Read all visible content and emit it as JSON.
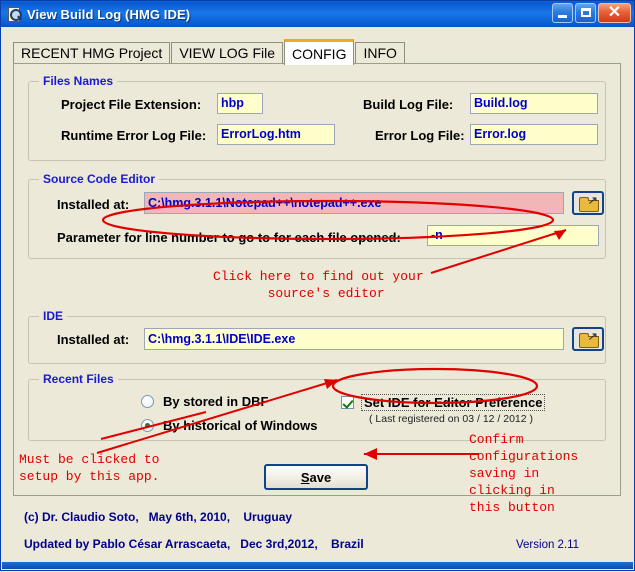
{
  "window": {
    "title": "View Build Log (HMG IDE)",
    "icon": "magnifier-document-icon",
    "buttons": {
      "minimize": "minimize-icon",
      "maximize": "maximize-icon",
      "close": "close-icon"
    }
  },
  "tabs": [
    {
      "label": "RECENT HMG Project",
      "active": false
    },
    {
      "label": "VIEW LOG File",
      "active": false
    },
    {
      "label": "CONFIG",
      "active": true
    },
    {
      "label": "INFO",
      "active": false
    }
  ],
  "groups": {
    "files_names": {
      "legend": "Files Names",
      "fields": [
        {
          "label": "Project File Extension:",
          "value": "hbp"
        },
        {
          "label": "Build Log File:",
          "value": "Build.log"
        },
        {
          "label": "Runtime Error Log File:",
          "value": "ErrorLog.htm"
        },
        {
          "label": "Error Log File:",
          "value": "Error.log"
        }
      ]
    },
    "source_code_editor": {
      "legend": "Source Code Editor",
      "installed_label": "Installed at:",
      "installed_value": "C:\\hmg.3.1.1\\Notepad++\\notepad++.exe",
      "param_label": "Parameter for line number to go to for each file opened:",
      "param_value": "-n",
      "browse_icon": "open-folder-icon"
    },
    "ide": {
      "legend": "IDE",
      "installed_label": "Installed at:",
      "installed_value": "C:\\hmg.3.1.1\\IDE\\IDE.exe",
      "browse_icon": "open-folder-icon"
    },
    "recent_files": {
      "legend": "Recent Files",
      "radios": [
        {
          "label": "By stored in DBF",
          "selected": false
        },
        {
          "label": "By historical of Windows",
          "selected": true
        }
      ],
      "checkbox": {
        "label": "Set IDE  for  Editor Preference",
        "checked": true,
        "sub_label": "( Last registered on 03 / 12 / 2012 )"
      }
    }
  },
  "save_button": {
    "prefix": "S",
    "rest": "ave"
  },
  "annotations": [
    {
      "name": "annotation-editor-hint",
      "text": "Click here to find out your\n       source's editor"
    },
    {
      "name": "annotation-must-be-clicked",
      "text": "Must be clicked to\nsetup by this app."
    },
    {
      "name": "annotation-confirm-save",
      "text": "Confirm\nconfigurations\nsaving in\nclicking in\nthis button"
    }
  ],
  "footer": {
    "line1": "(c) Dr. Claudio Soto,   May 6th, 2010,    Uruguay",
    "line2": "Updated by Pablo César Arrascaeta,   Dec 3rd,2012,    Brazil",
    "version": "Version 2.11"
  },
  "colors": {
    "titlebar": "#0a5ad2",
    "field_bg": "#ffffcc",
    "field_text": "#0000c8",
    "highlight_field_bg": "#f3b6b6",
    "legend": "#1a1ad0",
    "annotation": "#e00000",
    "active_tab_accent": "#f5a623",
    "footer_text": "#00008b"
  }
}
